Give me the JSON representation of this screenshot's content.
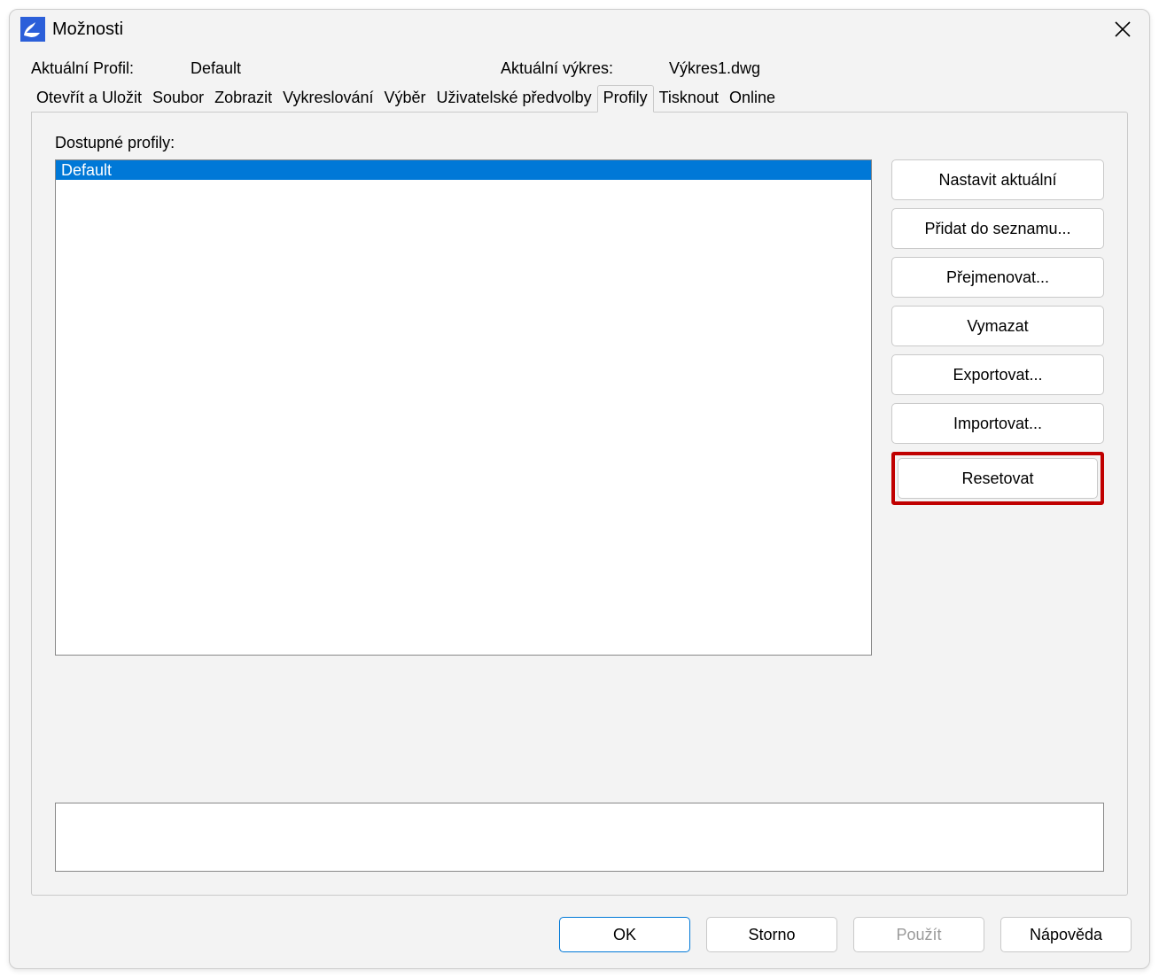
{
  "window": {
    "title": "Možnosti"
  },
  "info": {
    "profile_label": "Aktuální Profil:",
    "profile_value": "Default",
    "drawing_label": "Aktuální výkres:",
    "drawing_value": "Výkres1.dwg"
  },
  "tabs": {
    "open_save": "Otevřít a Uložit",
    "file": "Soubor",
    "display": "Zobrazit",
    "drafting": "Vykreslování",
    "selection": "Výběr",
    "user_prefs": "Uživatelské předvolby",
    "profiles": "Profily",
    "print": "Tisknout",
    "online": "Online"
  },
  "panel": {
    "available_label": "Dostupné profily:",
    "items": {
      "0": "Default"
    }
  },
  "buttons": {
    "set_current": "Nastavit aktuální",
    "add_to_list": "Přidat do seznamu...",
    "rename": "Přejmenovat...",
    "delete": "Vymazat",
    "export": "Exportovat...",
    "import": "Importovat...",
    "reset": "Resetovat"
  },
  "footer": {
    "ok": "OK",
    "cancel": "Storno",
    "apply": "Použít",
    "help": "Nápověda"
  }
}
